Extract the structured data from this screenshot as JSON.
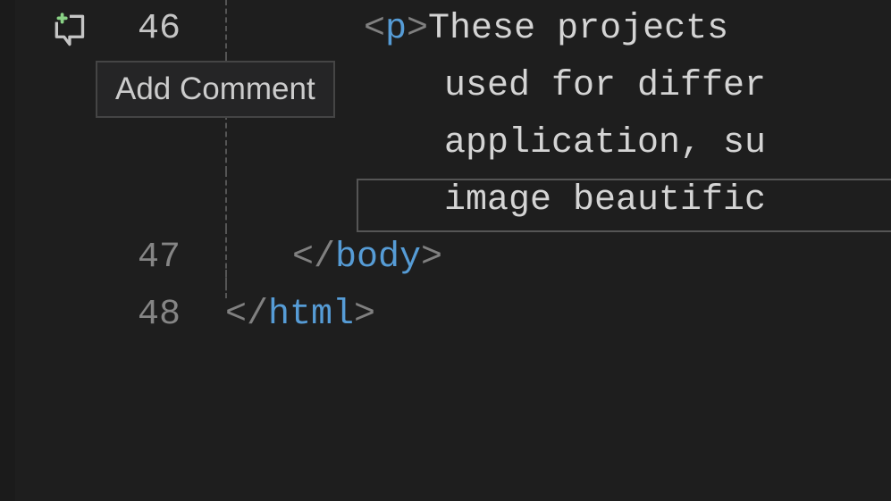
{
  "tooltip": {
    "label": "Add Comment"
  },
  "lines": {
    "l46": {
      "number": "46"
    },
    "l47": {
      "number": "47"
    },
    "l48": {
      "number": "48"
    }
  },
  "code": {
    "lt": "<",
    "lts": "</",
    "gt": ">",
    "p_tag": "p",
    "body_tag": "body",
    "html_tag": "html",
    "frag1": "These projects",
    "frag2": "used for differ",
    "frag3": "application, su",
    "frag4": "image beautific"
  },
  "icons": {
    "comment": "add-comment-icon"
  }
}
